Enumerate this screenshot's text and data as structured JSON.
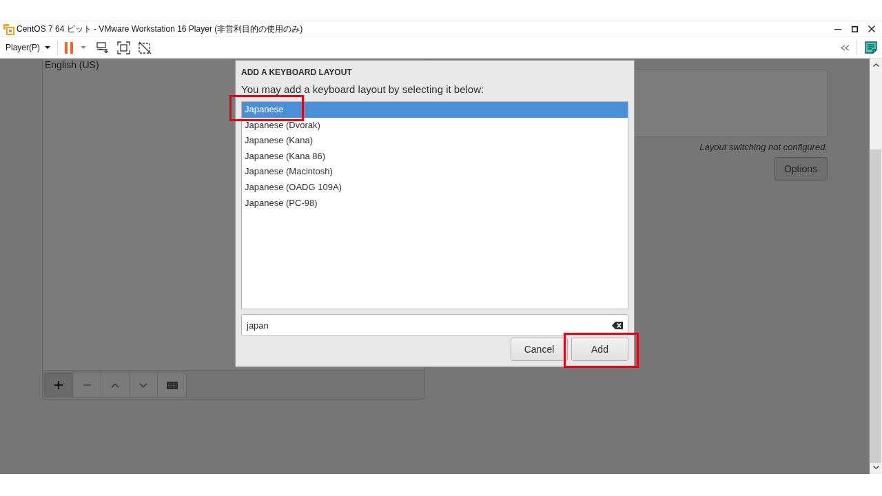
{
  "window": {
    "title": "CentOS 7 64 ビット - VMware Workstation 16 Player (非営利目的の使用のみ)"
  },
  "toolbar": {
    "menu": "Player(P)"
  },
  "layouts": {
    "items": [
      {
        "label": "English (US)"
      }
    ],
    "tools": [
      {
        "kind": "add",
        "pressed": true
      },
      {
        "kind": "remove",
        "pressed": false
      },
      {
        "kind": "up",
        "pressed": false
      },
      {
        "kind": "down",
        "pressed": false
      },
      {
        "kind": "preview",
        "pressed": false
      }
    ]
  },
  "switching": {
    "status": "Layout switching not configured.",
    "button": "Options"
  },
  "dialog": {
    "title": "ADD A KEYBOARD LAYOUT",
    "prompt": "You may add a keyboard layout by selecting it below:",
    "options": [
      {
        "label": "Japanese",
        "selected": true,
        "highlighted": true
      },
      {
        "label": "Japanese (Dvorak)",
        "selected": false,
        "highlighted": false
      },
      {
        "label": "Japanese (Kana)",
        "selected": false,
        "highlighted": false
      },
      {
        "label": "Japanese (Kana 86)",
        "selected": false,
        "highlighted": false
      },
      {
        "label": "Japanese (Macintosh)",
        "selected": false,
        "highlighted": false
      },
      {
        "label": "Japanese (OADG 109A)",
        "selected": false,
        "highlighted": false
      },
      {
        "label": "Japanese (PC-98)",
        "selected": false,
        "highlighted": false
      }
    ],
    "search": {
      "value": "japan"
    },
    "buttons": [
      {
        "label": "Cancel",
        "highlighted": false
      },
      {
        "label": "Add",
        "highlighted": true
      }
    ]
  }
}
